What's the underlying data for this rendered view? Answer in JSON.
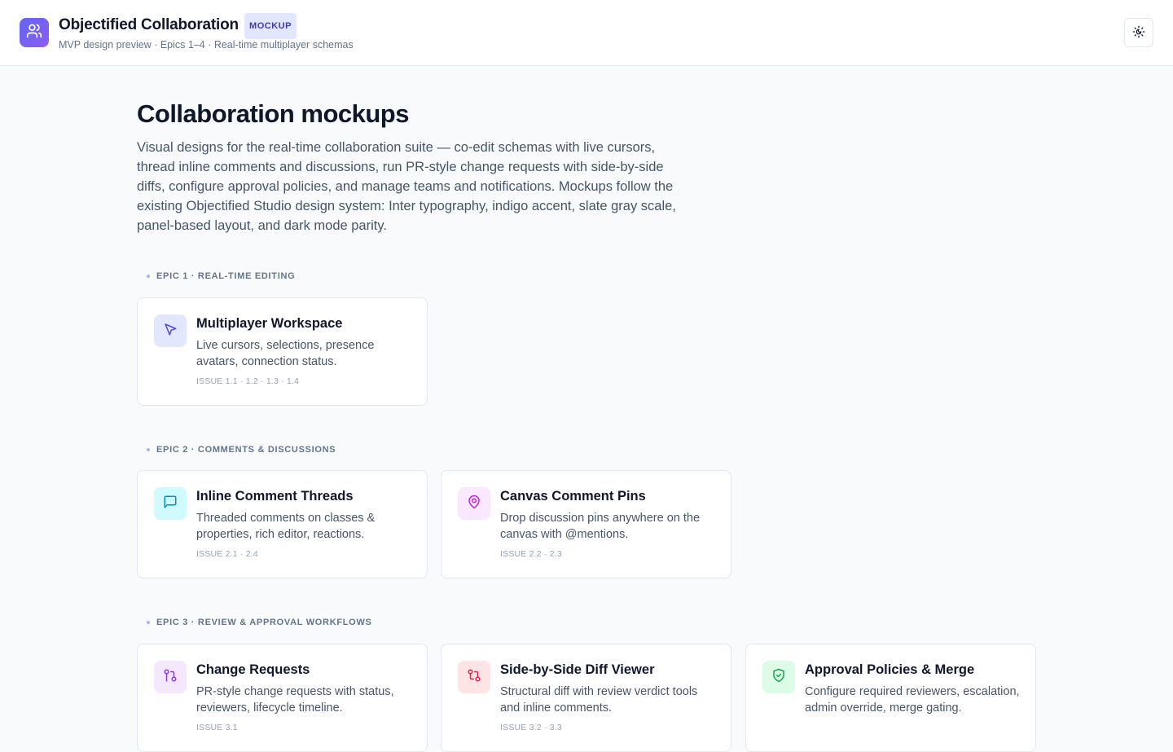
{
  "header": {
    "title": "Objectified Collaboration",
    "badge": "MOCKUP",
    "subtitle": "MVP design preview · Epics 1–4 · Real-time multiplayer schemas",
    "logo_icon": "users-icon",
    "theme_toggle_icon": "theme-toggle-icon"
  },
  "page": {
    "title": "Collaboration mockups",
    "intro": "Visual designs for the real-time collaboration suite — co-edit schemas with live cursors, thread inline comments and discussions, run PR-style change requests with side-by-side diffs, configure approval policies, and manage teams and notifications. Mockups follow the existing Objectified Studio design system: Inter typography, indigo accent, slate gray scale, panel-based layout, and dark mode parity."
  },
  "sections": [
    {
      "label": "EPIC 1 · REAL-TIME EDITING",
      "cards": [
        {
          "title": "Multiplayer Workspace",
          "desc": "Live cursors, selections, presence avatars, connection status.",
          "issue": "ISSUE 1.1 · 1.2 · 1.3 · 1.4",
          "icon": "cursor-icon",
          "icon_bg": "#e0e7ff",
          "icon_color": "#4f46e5"
        }
      ]
    },
    {
      "label": "EPIC 2 · COMMENTS & DISCUSSIONS",
      "cards": [
        {
          "title": "Inline Comment Threads",
          "desc": "Threaded comments on classes & properties, rich editor, reactions.",
          "issue": "ISSUE 2.1 · 2.4",
          "icon": "message-square-icon",
          "icon_bg": "#cffafe",
          "icon_color": "#0891b2"
        },
        {
          "title": "Canvas Comment Pins",
          "desc": "Drop discussion pins anywhere on the canvas with @mentions.",
          "issue": "ISSUE 2.2 · 2.3",
          "icon": "map-pin-icon",
          "icon_bg": "#fae8ff",
          "icon_color": "#c026d3"
        }
      ]
    },
    {
      "label": "EPIC 3 · REVIEW & APPROVAL WORKFLOWS",
      "cards": [
        {
          "title": "Change Requests",
          "desc": "PR-style change requests with status, reviewers, lifecycle timeline.",
          "issue": "ISSUE 3.1",
          "icon": "git-pull-request-icon",
          "icon_bg": "#f3e8ff",
          "icon_color": "#9333ea"
        },
        {
          "title": "Side-by-Side Diff Viewer",
          "desc": "Structural diff with review verdict tools and inline comments.",
          "issue": "ISSUE 3.2 · 3.3",
          "icon": "git-compare-icon",
          "icon_bg": "#ffe4e6",
          "icon_color": "#e11d48"
        },
        {
          "title": "Approval Policies & Merge",
          "desc": "Configure required reviewers, escalation, admin override, merge gating.",
          "issue": "",
          "icon": "shield-check-icon",
          "icon_bg": "#dcfce7",
          "icon_color": "#16a34a"
        }
      ]
    }
  ]
}
